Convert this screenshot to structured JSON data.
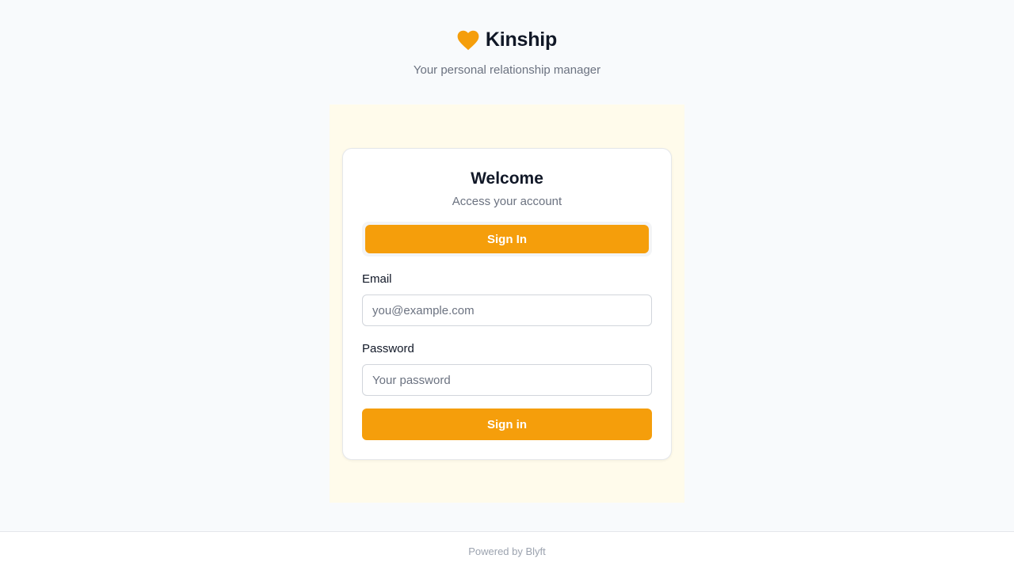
{
  "brand": {
    "name": "Kinship",
    "tagline": "Your personal relationship manager",
    "icon": "heart-icon",
    "accent_color": "#f59e0b"
  },
  "card": {
    "title": "Welcome",
    "subtitle": "Access your account",
    "tabs": [
      {
        "label": "Sign In",
        "active": true
      }
    ],
    "email": {
      "label": "Email",
      "placeholder": "you@example.com",
      "value": ""
    },
    "password": {
      "label": "Password",
      "placeholder": "Your password",
      "value": ""
    },
    "submit_label": "Sign in"
  },
  "footer": {
    "text": "Powered by Blyft"
  },
  "colors": {
    "page_background": "#f8fafc",
    "panel_background": "#fffbeb",
    "primary": "#f59e0b"
  }
}
